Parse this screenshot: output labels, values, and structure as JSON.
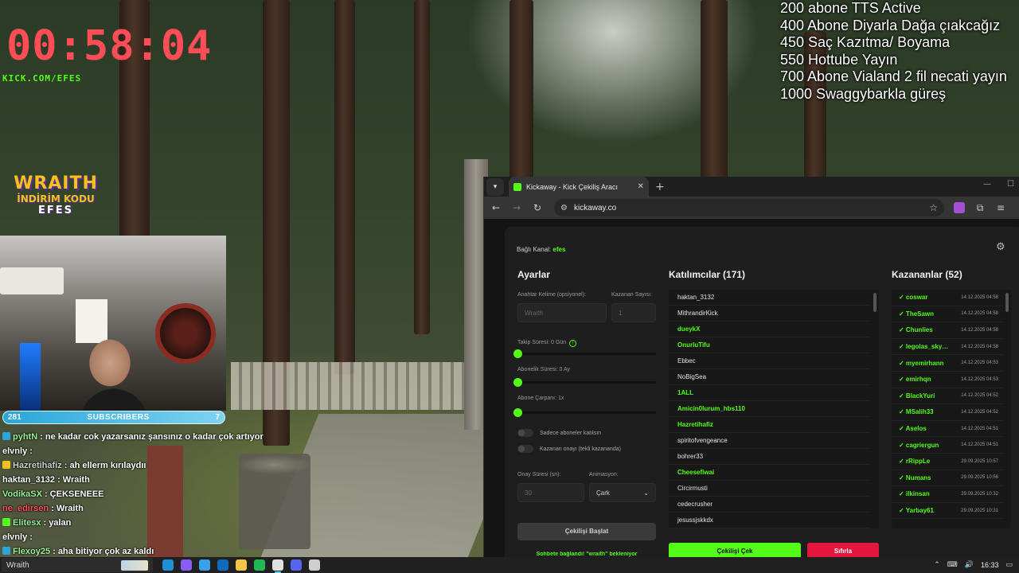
{
  "overlay": {
    "timer": "00:58:04",
    "kick_url": "KICK.COM/EFES",
    "goals": [
      "200 abone TTS Active",
      "400 Abone Diyarla Dağa çıakcağız",
      "450 Saç Kazıtma/ Boyama",
      "550 Hottube Yayın",
      "700 Abone Vialand 2 fil necati yayın",
      "1000 Swaggybarkla güreş"
    ],
    "promo": {
      "title": "WRAITH",
      "line": "İNDİRİM KODU",
      "code": "EFES"
    },
    "subbar": {
      "left": "281",
      "label": "SUBSCRIBERS",
      "right": "7",
      "fill": 0.98
    },
    "chat": [
      {
        "user": "pyhtN",
        "color": "#9bf19a",
        "badge": "#2aa6d8",
        "text": ": ne kadar cok yazarsanız şansınız o kadar çok artıyor"
      },
      {
        "user": "elvnly",
        "color": "#ffffff",
        "badge": "",
        "text": ":"
      },
      {
        "user": "Hazretihafiz",
        "color": "#cfcfcf",
        "badge": "#f6c21a",
        "text": ": ah ellerm kırılaydıı"
      },
      {
        "user": "haktan_3132",
        "color": "#ffffff",
        "badge": "",
        "text": ": Wraith"
      },
      {
        "user": "VodikaSX",
        "color": "#9bf19a",
        "badge": "",
        "text": ": ÇEKSENEEE"
      },
      {
        "user": "ne_edirsen",
        "color": "#ff4d57",
        "badge": "",
        "text": ": Wraith"
      },
      {
        "user": "Elitesx",
        "color": "#9bf19a",
        "badge": "#53fc18",
        "text": ": yalan"
      },
      {
        "user": "elvnly",
        "color": "#ffffff",
        "badge": "",
        "text": ":"
      },
      {
        "user": "Flexoy25",
        "color": "#9bf19a",
        "badge": "#2aa6d8",
        "text": ": aha bitiyor çok az kaldı"
      }
    ]
  },
  "browser": {
    "tab_title": "Kickaway - Kick Çekiliş Aracı",
    "url": "kickaway.co",
    "page": {
      "linked_label": "Bağlı Kanal:",
      "linked_channel": "efes",
      "settings": {
        "title": "Ayarlar",
        "keyword_label": "Anahtar Kelime (opsiyonel):",
        "keyword_value": "Wraith",
        "winner_count_label": "Kazanan Sayısı:",
        "winner_count_value": "1",
        "follow_label": "Takip Süresi: 0 Gün",
        "follow_value": 0,
        "sub_label": "Abonelik Süresi: 0 Ay",
        "sub_value": 0,
        "multiplier_label": "Abone Çarpanı: 1x",
        "multiplier_value": 0,
        "only_subs_label": "Sadece aboneler katılsın",
        "approval_label": "Kazanan onayı (tekli kazananda)",
        "approval_time_label": "Onay Süresi (sn):",
        "approval_time_value": "30",
        "animation_label": "Animasyon:",
        "animation_value": "Çark",
        "start_button": "Çekilişi Başlat",
        "waiting_text": "Sohbete bağlandı! \"wraith\" bekleniyor"
      },
      "participants": {
        "title": "Katılımcılar (171)",
        "items": [
          {
            "name": "haktan_3132",
            "sub": false
          },
          {
            "name": "MithrandirKick",
            "sub": false
          },
          {
            "name": "dueykX",
            "sub": true
          },
          {
            "name": "OnurluTifu",
            "sub": true
          },
          {
            "name": "Ebbec",
            "sub": false
          },
          {
            "name": "NoBigSea",
            "sub": false
          },
          {
            "name": "1ALL",
            "sub": true
          },
          {
            "name": "Amicin0lurum_hbs110",
            "sub": true
          },
          {
            "name": "Hazretihafiz",
            "sub": true
          },
          {
            "name": "spiritofvengeance",
            "sub": false
          },
          {
            "name": "bohrer33",
            "sub": false
          },
          {
            "name": "Cheesefiwai",
            "sub": true
          },
          {
            "name": "Circirmusti",
            "sub": false
          },
          {
            "name": "cedecrusher",
            "sub": false
          },
          {
            "name": "jesussjskkdx",
            "sub": false
          }
        ],
        "draw_button": "Çekilişi Çek",
        "reset_button": "Sıfırla"
      },
      "winners": {
        "title": "Kazananlar (52)",
        "items": [
          {
            "name": "✓ coswar",
            "date": "14.12.2025 04:58"
          },
          {
            "name": "✓ TheSawn",
            "date": "14.12.2025 04:58"
          },
          {
            "name": "✓ Chunlies",
            "date": "14.12.2025 04:58"
          },
          {
            "name": "✓ legolas_sky…",
            "date": "14.12.2025 04:58"
          },
          {
            "name": "✓ myemirhann",
            "date": "14.12.2025 04:53"
          },
          {
            "name": "✓ emirhqn",
            "date": "14.12.2025 04:53"
          },
          {
            "name": "✓ BlackYuri",
            "date": "14.12.2025 04:52"
          },
          {
            "name": "✓ MSalih33",
            "date": "14.12.2025 04:52"
          },
          {
            "name": "✓ Aselos",
            "date": "14.12.2025 04:51"
          },
          {
            "name": "✓ cagriergun",
            "date": "14.12.2025 04:51"
          },
          {
            "name": "✓ rRippLe",
            "date": "29.09.2025 10:57"
          },
          {
            "name": "✓ Numans",
            "date": "29.09.2025 10:56"
          },
          {
            "name": "✓ ilkinsan",
            "date": "29.09.2025 10:32"
          },
          {
            "name": "✓ Yarbay61",
            "date": "29.09.2025 10:31"
          }
        ]
      }
    }
  },
  "taskbar": {
    "search_text": "Wraith",
    "time": "16:33",
    "apps": [
      {
        "icon": "edge-icon",
        "color": "#1f8fd6"
      },
      {
        "icon": "copilot-icon",
        "color": "#8a5cf6"
      },
      {
        "icon": "store-icon",
        "color": "#3aa0e8"
      },
      {
        "icon": "outlook-icon",
        "color": "#0f6cbd"
      },
      {
        "icon": "file-explorer-icon",
        "color": "#f4c542"
      },
      {
        "icon": "spotify-icon",
        "color": "#1db954"
      },
      {
        "icon": "chrome-icon",
        "color": "#e0e0e0"
      },
      {
        "icon": "discord-icon",
        "color": "#5865f2"
      },
      {
        "icon": "obs-icon",
        "color": "#cfcfcf"
      }
    ]
  }
}
